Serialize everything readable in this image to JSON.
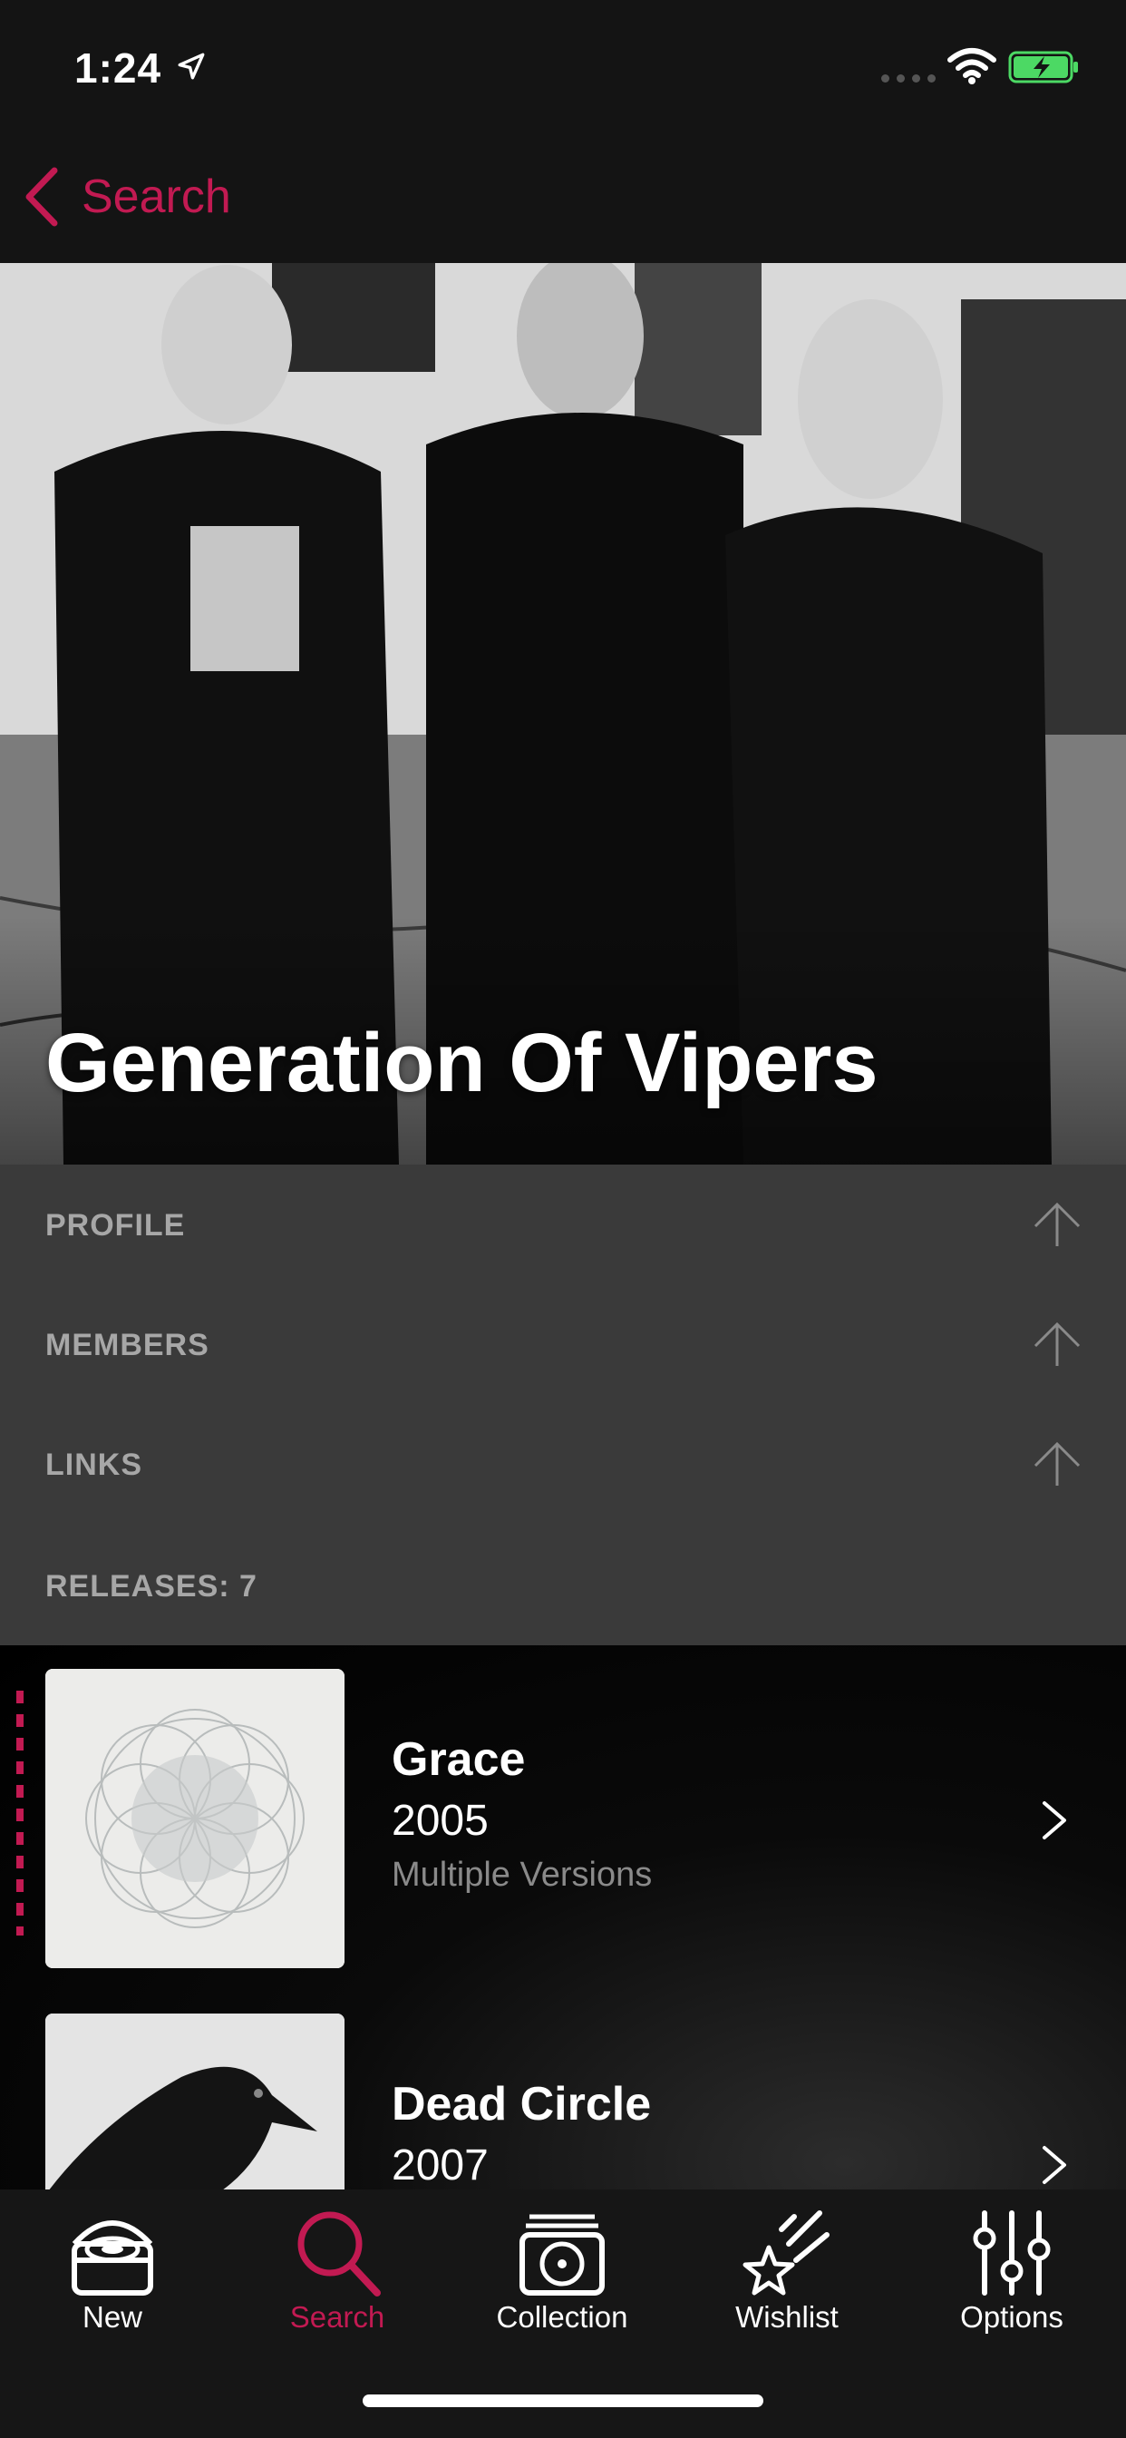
{
  "status_bar": {
    "time": "1:24"
  },
  "nav": {
    "back_label": "Search"
  },
  "artist": {
    "name": "Generation Of Vipers"
  },
  "sections": [
    {
      "label": "PROFILE"
    },
    {
      "label": "MEMBERS"
    },
    {
      "label": "LINKS"
    },
    {
      "label": "RELEASES: 7"
    }
  ],
  "releases": [
    {
      "title": "Grace",
      "year": "2005",
      "subtitle": "Multiple Versions"
    },
    {
      "title": "Dead Circle",
      "year": "2007",
      "subtitle": ""
    }
  ],
  "tabs": [
    {
      "label": "New",
      "icon": "vinyl-crate-icon"
    },
    {
      "label": "Search",
      "icon": "search-icon"
    },
    {
      "label": "Collection",
      "icon": "record-stack-icon"
    },
    {
      "label": "Wishlist",
      "icon": "shooting-star-icon"
    },
    {
      "label": "Options",
      "icon": "sliders-icon"
    }
  ],
  "colors": {
    "accent": "#c21a52",
    "background": "#141414",
    "section_bg": "#3a3a3a",
    "muted_text": "#a7a7a7"
  }
}
